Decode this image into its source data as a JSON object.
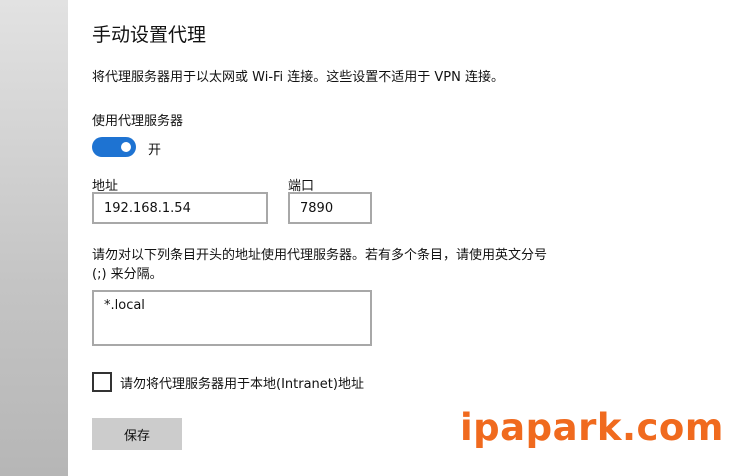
{
  "page": {
    "title": "手动设置代理",
    "description": "将代理服务器用于以太网或 Wi-Fi 连接。这些设置不适用于 VPN 连接。"
  },
  "proxy_toggle": {
    "label": "使用代理服务器",
    "state_text": "开",
    "on": true,
    "accent_color": "#1e73d2"
  },
  "address": {
    "label": "地址",
    "value": "192.168.1.54"
  },
  "port": {
    "label": "端口",
    "value": "7890"
  },
  "exceptions": {
    "description": "请勿对以下列条目开头的地址使用代理服务器。若有多个条目，请使用英文分号 (;) 来分隔。",
    "value": "*.local"
  },
  "local_bypass": {
    "label": "请勿将代理服务器用于本地(Intranet)地址",
    "checked": false
  },
  "save_button": {
    "label": "保存"
  },
  "watermark": {
    "text": "ipapark.com",
    "color": "#f06a1e"
  }
}
